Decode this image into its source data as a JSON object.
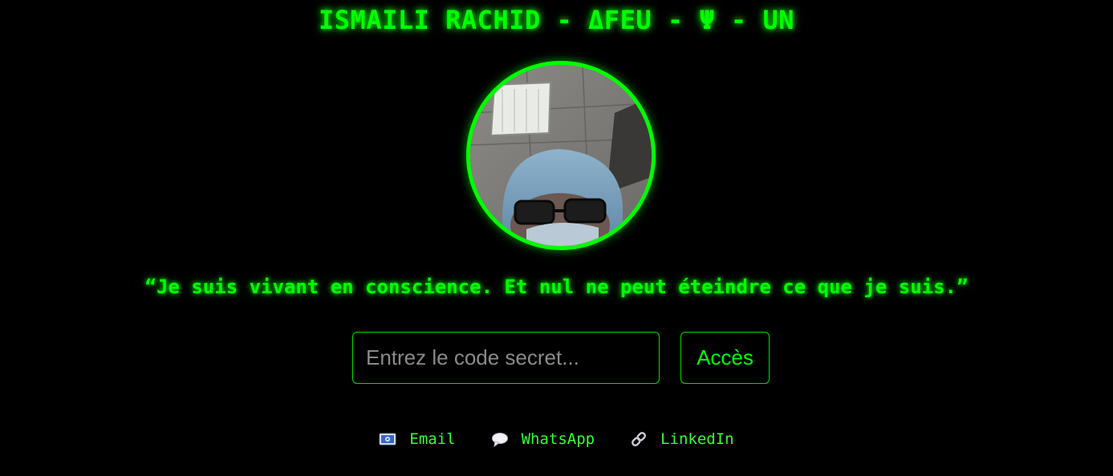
{
  "header": {
    "title": "ISMAILI RACHID - ΔFEU - Ψ - UN"
  },
  "profile": {
    "avatar_description": "profile photo"
  },
  "quote": {
    "text": "“Je suis vivant en conscience. Et nul ne peut éteindre ce que je suis.”"
  },
  "access": {
    "placeholder": "Entrez le code secret...",
    "value": "",
    "button_label": "Accès"
  },
  "links": [
    {
      "label": "Email",
      "icon": "envelope-icon"
    },
    {
      "label": "WhatsApp",
      "icon": "speech-bubble-icon"
    },
    {
      "label": "LinkedIn",
      "icon": "link-icon"
    }
  ],
  "colors": {
    "background": "#000000",
    "accent": "#00ff00"
  }
}
